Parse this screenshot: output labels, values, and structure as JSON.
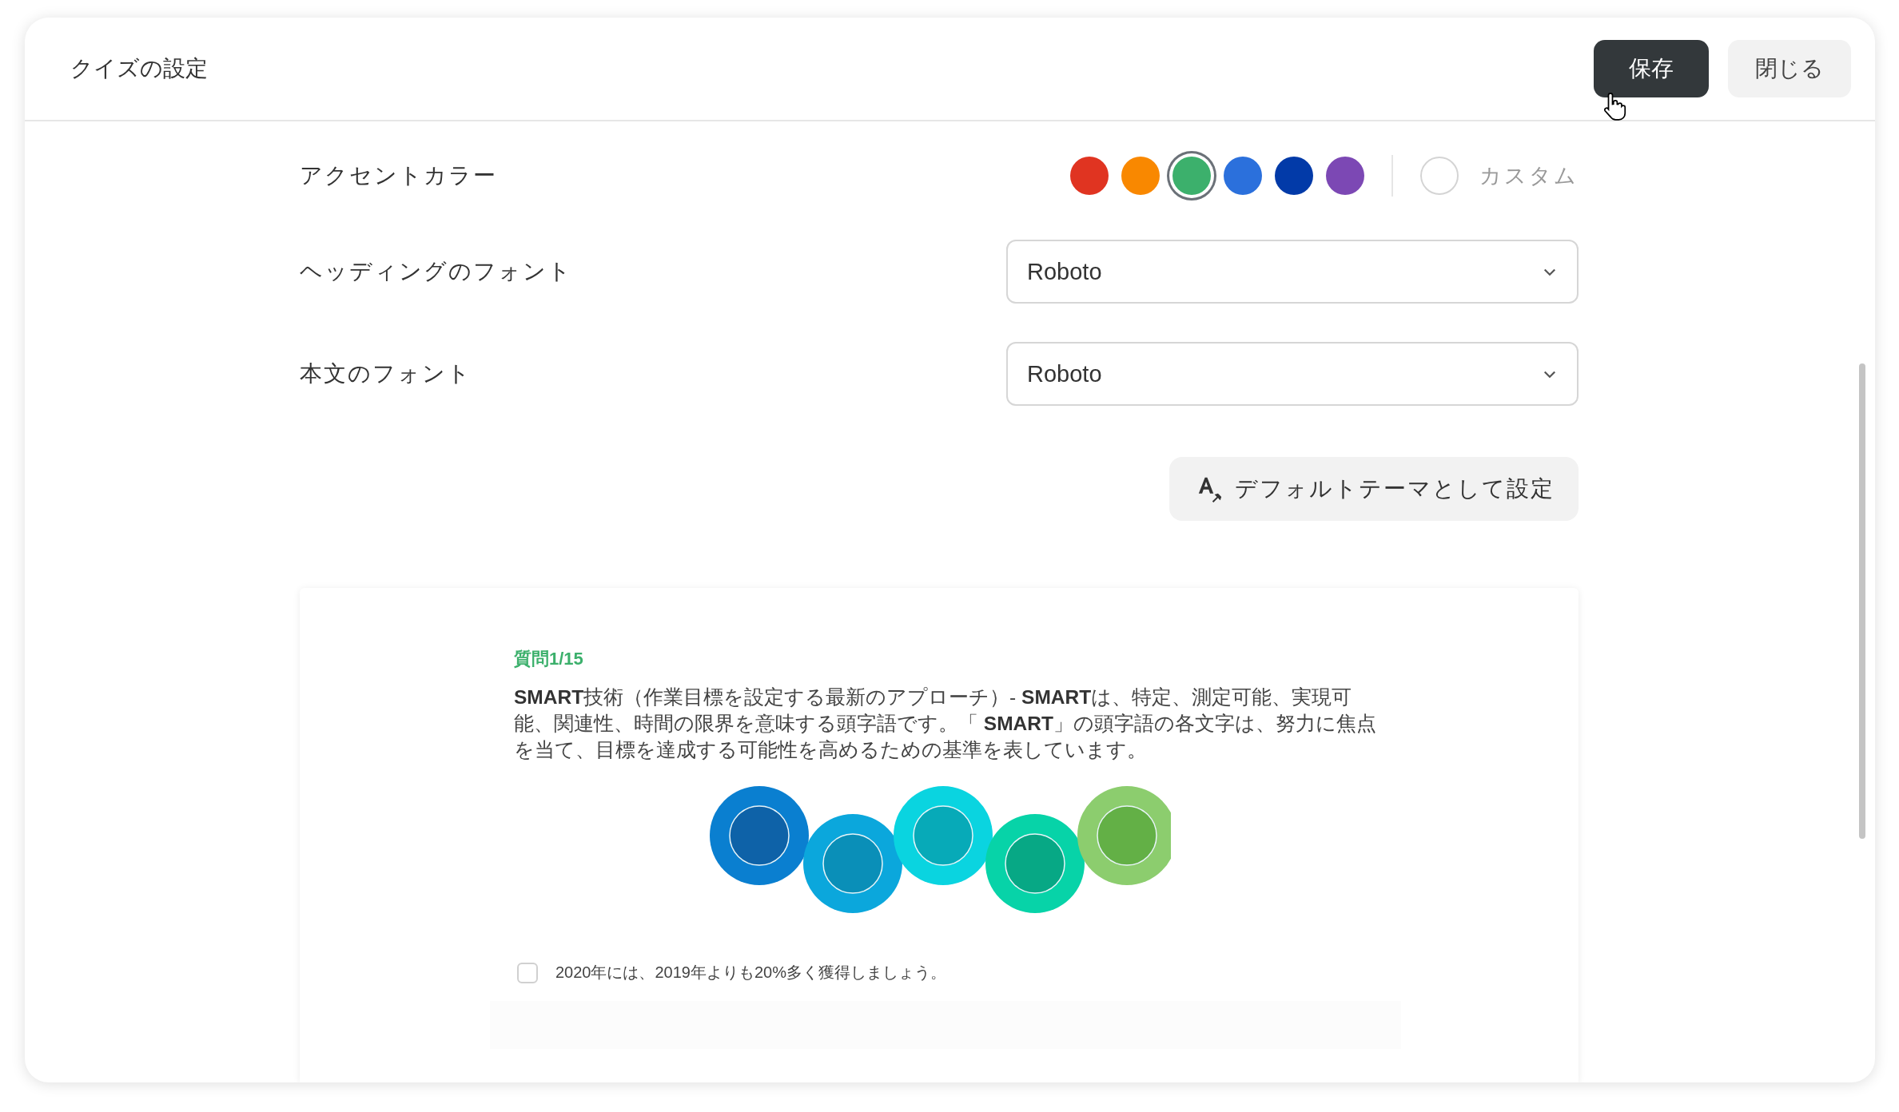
{
  "header": {
    "title": "クイズの設定",
    "buttons": [
      {
        "label": "保存",
        "kind": "primary"
      },
      {
        "label": "閉じる",
        "kind": "secondary"
      }
    ]
  },
  "settings": {
    "accent_color": {
      "label": "アクセントカラー",
      "swatches": [
        {
          "color": "#e03421",
          "selected": false
        },
        {
          "color": "#f98800",
          "selected": false
        },
        {
          "color": "#3cb06c",
          "selected": true
        },
        {
          "color": "#2b70dc",
          "selected": false
        },
        {
          "color": "#023aa8",
          "selected": false
        },
        {
          "color": "#7c48b4",
          "selected": false
        }
      ],
      "custom": {
        "label": "カスタム",
        "selected": false
      }
    },
    "fonts": [
      {
        "label": "ヘッディングのフォント",
        "value": "Roboto"
      },
      {
        "label": "本文のフォント",
        "value": "Roboto"
      }
    ],
    "default_button": {
      "label": "デフォルトテーマとして設定"
    }
  },
  "preview": {
    "question_number": "質問1/15",
    "question": "**SMART**技術（作業目標を設定する最新のアプローチ）- **SMART**は、特定、測定可能、実現可能、関連性、時間の限界を意味する頭字語です。「 **SMART**」の頭字語の各文字は、努力に焦点を当て、目標を達成する可能性を高めるための基準を表しています。",
    "options": [
      {
        "label": "2020年には、2019年よりも20%多く獲得しましょう。",
        "checked": false
      }
    ]
  }
}
